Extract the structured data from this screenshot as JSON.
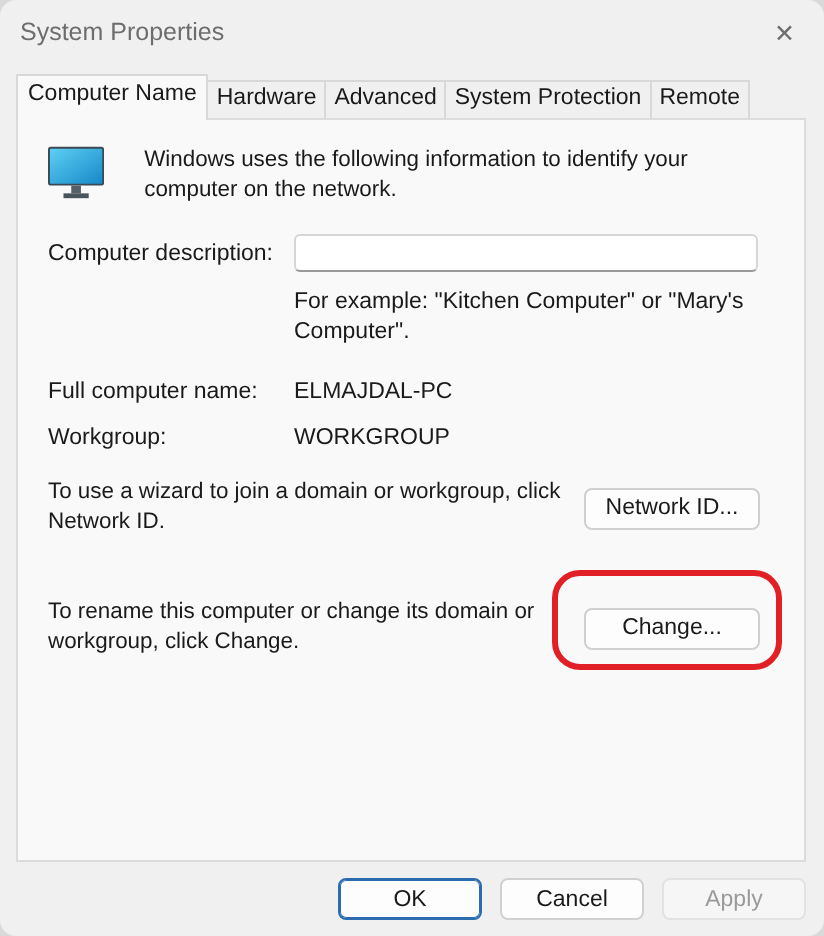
{
  "window": {
    "title": "System Properties",
    "close": "✕"
  },
  "tabs": [
    {
      "label": "Computer Name",
      "selected": true
    },
    {
      "label": "Hardware",
      "selected": false
    },
    {
      "label": "Advanced",
      "selected": false
    },
    {
      "label": "System Protection",
      "selected": false
    },
    {
      "label": "Remote",
      "selected": false
    }
  ],
  "intro": "Windows uses the following information to identify your computer on the network.",
  "description": {
    "label": "Computer description:",
    "hint": "For example: \"Kitchen Computer\" or \"Mary's Computer\"."
  },
  "fields": [
    {
      "label": "Full computer name:",
      "value": "ELMAJDAL-PC"
    },
    {
      "label": "Workgroup:",
      "value": "WORKGROUP"
    }
  ],
  "actions": [
    {
      "text": "To use a wizard to join a domain or workgroup, click Network ID.",
      "button": "Network ID...",
      "highlighted": false
    },
    {
      "text": "To rename this computer or change its domain or workgroup, click Change.",
      "button": "Change...",
      "highlighted": true
    }
  ],
  "buttons": [
    {
      "label": "OK",
      "default": true,
      "disabled": false
    },
    {
      "label": "Cancel",
      "default": false,
      "disabled": false
    },
    {
      "label": "Apply",
      "default": false,
      "disabled": true
    }
  ]
}
